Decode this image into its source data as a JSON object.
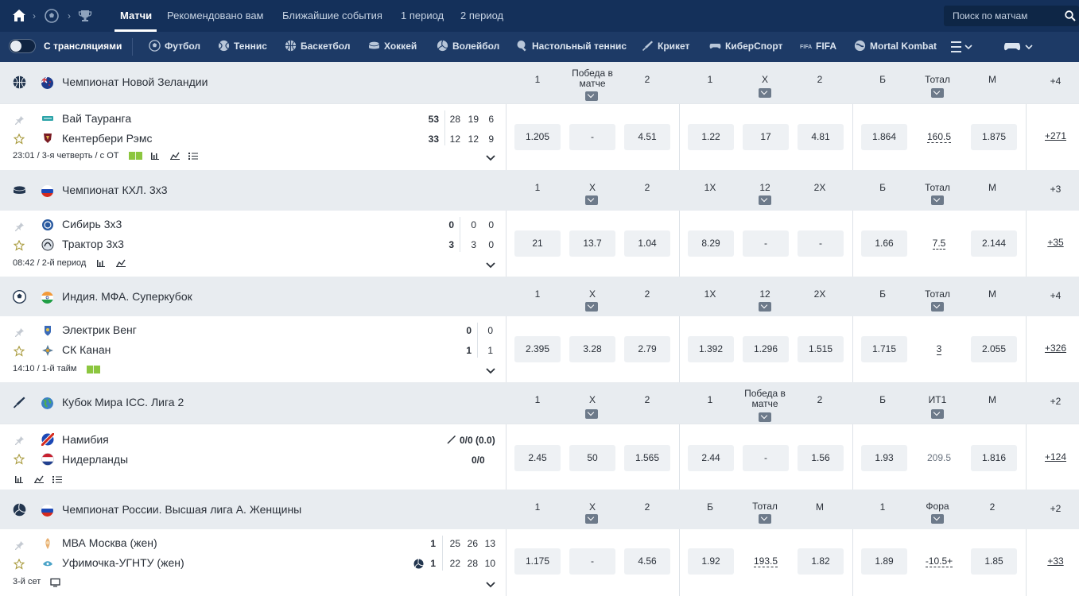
{
  "nav": {
    "tabs": [
      "Матчи",
      "Рекомендовано вам",
      "Ближайшие события",
      "1 период",
      "2 период"
    ],
    "search_placeholder": "Поиск по матчам"
  },
  "sportsbar": {
    "live_label": "С трансляциями",
    "sports": [
      "Футбол",
      "Теннис",
      "Баскетбол",
      "Хоккей",
      "Волейбол",
      "Настольный теннис",
      "Крикет",
      "КиберСпорт",
      "FIFA",
      "Mortal Kombat"
    ]
  },
  "colors": {
    "nav_bg": "#14305a",
    "sportsbar_bg": "#1d3a66",
    "league_bg": "#e8ecf0",
    "odd_bg": "#eef1f4"
  },
  "leagues": [
    {
      "sport": "basketball-icon",
      "name": "Чемпионат Новой Зеландии",
      "columns": [
        "1",
        "Победа в матче",
        "2",
        "1",
        "X",
        "2",
        "Б",
        "Тотал",
        "М"
      ],
      "plus": "+4",
      "match": {
        "team1": "Вай Тауранга",
        "team2": "Кентербери Рэмс",
        "score1": [
          "53",
          "28",
          "19",
          "6"
        ],
        "score2": [
          "33",
          "12",
          "12",
          "9"
        ],
        "status": "23:01 / 3-я четверть / с ОТ",
        "odds": [
          "1.205",
          "-",
          "4.51",
          "1.22",
          "17",
          "4.81",
          "1.864",
          "160.5",
          "1.875"
        ],
        "more": "+271"
      }
    },
    {
      "sport": "hockey-icon",
      "name": "Чемпионат КХЛ. 3x3",
      "columns": [
        "1",
        "X",
        "2",
        "1X",
        "12",
        "2X",
        "Б",
        "Тотал",
        "М"
      ],
      "plus": "+3",
      "match": {
        "team1": "Сибирь 3x3",
        "team2": "Трактор 3x3",
        "score1": [
          "0",
          "0",
          "0"
        ],
        "score2": [
          "3",
          "3",
          "0"
        ],
        "status": "08:42 / 2-й период",
        "odds": [
          "21",
          "13.7",
          "1.04",
          "8.29",
          "-",
          "-",
          "1.66",
          "7.5",
          "2.144"
        ],
        "more": "+35"
      }
    },
    {
      "sport": "football-icon",
      "name": "Индия. МФА. Суперкубок",
      "columns": [
        "1",
        "X",
        "2",
        "1X",
        "12",
        "2X",
        "Б",
        "Тотал",
        "М"
      ],
      "plus": "+4",
      "match": {
        "team1": "Электрик Венг",
        "team2": "СК Канан",
        "score1": [
          "0",
          "0"
        ],
        "score2": [
          "1",
          "1"
        ],
        "status": "14:10 / 1-й тайм",
        "odds": [
          "2.395",
          "3.28",
          "2.79",
          "1.392",
          "1.296",
          "1.515",
          "1.715",
          "3",
          "2.055"
        ],
        "more": "+326"
      }
    },
    {
      "sport": "cricket-icon",
      "name": "Кубок Мира ICC. Лига 2",
      "columns": [
        "1",
        "X",
        "2",
        "1",
        "Победа в матче",
        "2",
        "Б",
        "ИТ1",
        "М"
      ],
      "plus": "+2",
      "match": {
        "team1": "Намибия",
        "team2": "Нидерланды",
        "score1_text": "0/0 (0.0)",
        "score2_text": "0/0",
        "status": "",
        "odds": [
          "2.45",
          "50",
          "1.565",
          "2.44",
          "-",
          "1.56",
          "1.93",
          "209.5",
          "1.816"
        ],
        "more": "+124"
      }
    },
    {
      "sport": "volleyball-icon",
      "name": "Чемпионат России. Высшая лига А. Женщины",
      "columns": [
        "1",
        "X",
        "2",
        "Б",
        "Тотал",
        "М",
        "1",
        "Фора",
        "2"
      ],
      "plus": "+2",
      "match": {
        "team1": "МВА Москва (жен)",
        "team2": "Уфимочка-УГНТУ (жен)",
        "score1": [
          "1",
          "25",
          "26",
          "13"
        ],
        "score2": [
          "1",
          "22",
          "28",
          "10"
        ],
        "status": "3-й сет",
        "odds": [
          "1.175",
          "-",
          "4.56",
          "1.92",
          "193.5",
          "1.82",
          "1.89",
          "-10.5+",
          "1.85"
        ],
        "more": "+33"
      }
    }
  ]
}
